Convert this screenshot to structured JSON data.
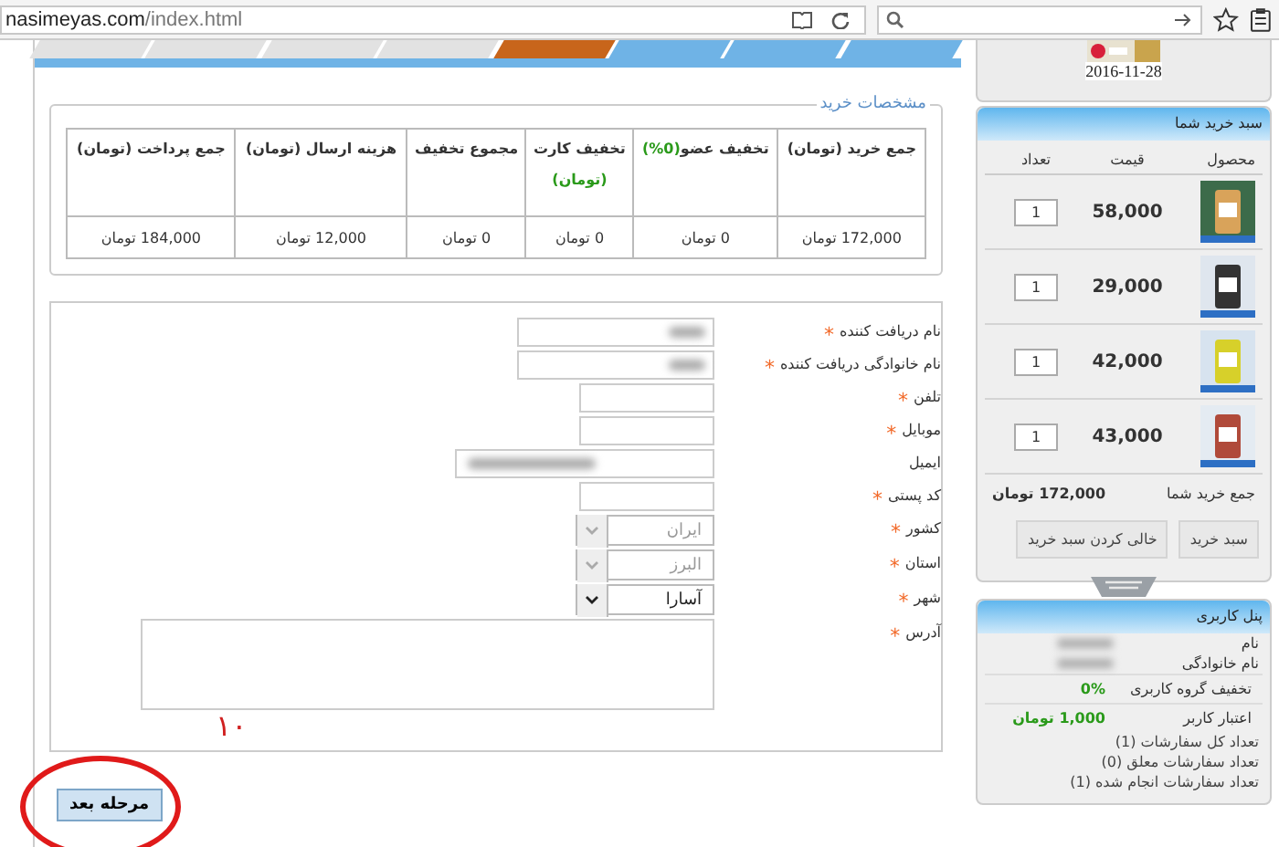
{
  "browser": {
    "url_host": "nasimeyas.com",
    "url_path": "/index.html"
  },
  "steps": [
    {
      "kind": "done"
    },
    {
      "kind": "done"
    },
    {
      "kind": "done"
    },
    {
      "kind": "done"
    },
    {
      "kind": "current"
    },
    {
      "kind": "todo"
    },
    {
      "kind": "todo"
    },
    {
      "kind": "todo"
    }
  ],
  "summary": {
    "legend": "مشخصات خرید",
    "columns": [
      {
        "label": "جمع خرید (تومان)"
      },
      {
        "label": "تخفیف عضو",
        "note": "(0%)"
      },
      {
        "label": "تخفیف کارت",
        "note": "(تومان)"
      },
      {
        "label": "مجموع تخفیف"
      },
      {
        "label": "هزینه ارسال (تومان)"
      },
      {
        "label": "جمع پرداخت (تومان)"
      }
    ],
    "values": [
      "172,000 تومان",
      "0 تومان",
      "0 تومان",
      "0 تومان",
      "12,000 تومان",
      "184,000 تومان"
    ]
  },
  "fields": [
    {
      "label": "نام دریافت کننده",
      "required_mark": "*",
      "kind": "wide",
      "blurred": true
    },
    {
      "label": "نام خانوادگی دریافت کننده",
      "required_mark": "*",
      "kind": "wide",
      "blurred": true
    },
    {
      "label": "تلفن",
      "required_mark": "*",
      "kind": "short"
    },
    {
      "label": "موبایل",
      "required_mark": "*",
      "kind": "short"
    },
    {
      "label": "ایمیل",
      "kind": "email",
      "blurred": true
    },
    {
      "label": "کد پستی",
      "required_mark": "*",
      "kind": "short"
    },
    {
      "label": "کشور",
      "required_mark": "*",
      "kind": "select",
      "value": "ایران",
      "disabled": true
    },
    {
      "label": "استان",
      "required_mark": "*",
      "kind": "select",
      "value": "البرز",
      "disabled": true
    },
    {
      "label": "شهر",
      "required_mark": "*",
      "kind": "select",
      "value": "آسارا",
      "disabled": false
    },
    {
      "label": "آدرس",
      "required_mark": "*",
      "kind": "textarea"
    }
  ],
  "annotation": {
    "number": "۱۰"
  },
  "next_button": "مرحله بعد",
  "sidebar": {
    "date": "2016-11-28",
    "cart": {
      "title": "سبد خرید شما",
      "columns": [
        "محصول",
        "قیمت",
        "تعداد"
      ],
      "items": [
        {
          "price": "58,000",
          "qty": "1"
        },
        {
          "price": "29,000",
          "qty": "1"
        },
        {
          "price": "42,000",
          "qty": "1"
        },
        {
          "price": "43,000",
          "qty": "1"
        }
      ],
      "total_label": "جمع خرید شما",
      "total": "172,000 تومان",
      "buttons": [
        "سبد خرید",
        "خالی کردن سبد خرید"
      ]
    },
    "user": {
      "title": "پنل کاربری",
      "rows": [
        {
          "label": "نام",
          "blurred": true
        },
        {
          "label": "نام خانوادگی",
          "blurred": true
        },
        {
          "label": "تخفیف گروه کاربری",
          "value": "0%"
        },
        {
          "label": "اعتبار کاربر",
          "value": "1,000 تومان"
        }
      ],
      "lines": [
        "تعداد کل سفارشات (1)",
        "تعداد سفارشات معلق (0)",
        "تعداد سفارشات انجام شده (1)"
      ]
    }
  }
}
